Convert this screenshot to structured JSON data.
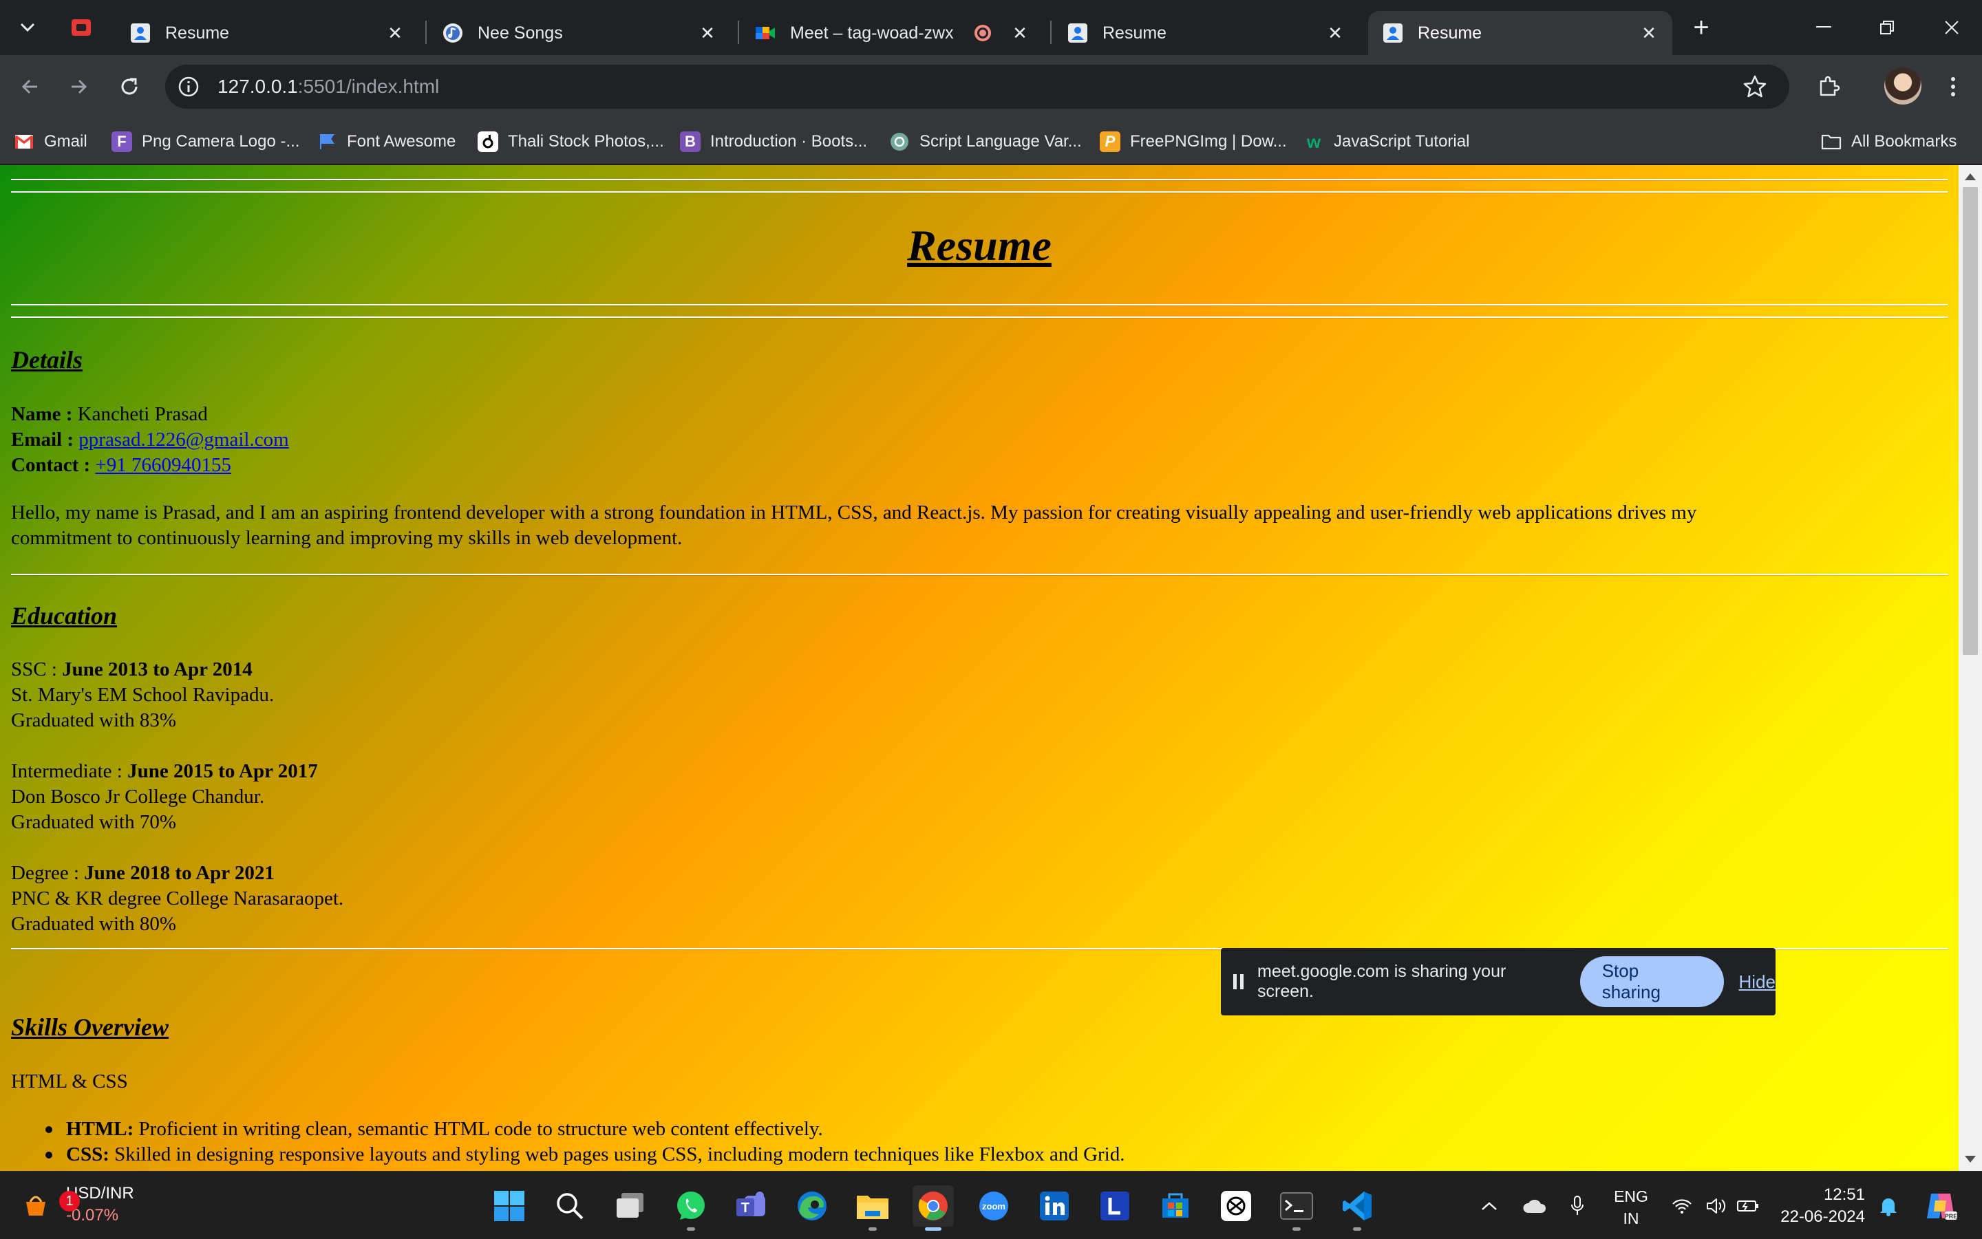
{
  "browser": {
    "tabs": [
      {
        "title": "Resume",
        "icon": "resume-favicon",
        "active": false
      },
      {
        "title": "Nee Songs",
        "icon": "music-favicon",
        "active": false
      },
      {
        "title": "Meet – tag-woad-zwx",
        "icon": "google-meet-favicon",
        "active": false,
        "recording": true
      },
      {
        "title": "Resume",
        "icon": "resume-favicon",
        "active": false
      },
      {
        "title": "Resume",
        "icon": "resume-favicon",
        "active": true
      }
    ],
    "close_glyph": "✕",
    "new_tab_glyph": "+",
    "url_host": "127.0.0.1",
    "url_path": ":5501/index.html",
    "bookmarks": [
      {
        "label": "Gmail",
        "icon": "gmail-icon"
      },
      {
        "label": "Png Camera Logo -...",
        "icon": "f-icon"
      },
      {
        "label": "Font Awesome",
        "icon": "flag-icon"
      },
      {
        "label": "Thali Stock Photos,...",
        "icon": "istock-icon"
      },
      {
        "label": "Introduction · Boots...",
        "icon": "bootstrap-icon"
      },
      {
        "label": "Script Language Var...",
        "icon": "openai-icon"
      },
      {
        "label": "FreePNGImg | Dow...",
        "icon": "freepng-icon"
      },
      {
        "label": "JavaScript Tutorial",
        "icon": "w3schools-icon"
      }
    ],
    "all_bookmarks": "All Bookmarks"
  },
  "resume": {
    "title": "Resume",
    "details_heading": "Details",
    "name_label": "Name :",
    "name_value": "Kancheti Prasad",
    "email_label": "Email :",
    "email_value": "pprasad.1226@gmail.com",
    "contact_label": "Contact :",
    "contact_value": "+91 7660940155",
    "intro_line1": "Hello, my name is Prasad, and I am an aspiring frontend developer with a strong foundation in HTML, CSS, and React.js. My passion for creating visually appealing and user-friendly web applications drives my",
    "intro_line2": "commitment to continuously learning and improving my skills in web development.",
    "education_heading": "Education",
    "education": [
      {
        "level": "SSC :",
        "dates": "June 2013 to Apr 2014",
        "school": "St. Mary's EM School Ravipadu.",
        "grade": "Graduated with 83%"
      },
      {
        "level": "Intermediate :",
        "dates": "June 2015 to Apr 2017",
        "school": "Don Bosco Jr College Chandur.",
        "grade": "Graduated with 70%"
      },
      {
        "level": "Degree :",
        "dates": "June 2018 to Apr 2021",
        "school": "PNC & KR degree College Narasaraopet.",
        "grade": "Graduated with 80%"
      }
    ],
    "skills_heading": "Skills Overview",
    "skills_group": "HTML & CSS",
    "skills": [
      {
        "name": "HTML:",
        "desc": "Proficient in writing clean, semantic HTML code to structure web content effectively."
      },
      {
        "name": "CSS:",
        "desc": "Skilled in designing responsive layouts and styling web pages using CSS, including modern techniques like Flexbox and Grid."
      }
    ]
  },
  "share_bar": {
    "message": "meet.google.com is sharing your screen.",
    "stop_label": "Stop sharing",
    "hide_label": "Hide"
  },
  "taskbar": {
    "widget_title": "USD/INR",
    "widget_value": "-0.07%",
    "widget_badge": "1",
    "lang_line1": "ENG",
    "lang_line2": "IN",
    "time": "12:51",
    "date": "22-06-2024"
  },
  "colors": {
    "page_gradient": [
      "#0c8c09",
      "#ffa000",
      "#ffff00"
    ],
    "link": "#0000ee",
    "stop_button": "#a8c7fa"
  }
}
